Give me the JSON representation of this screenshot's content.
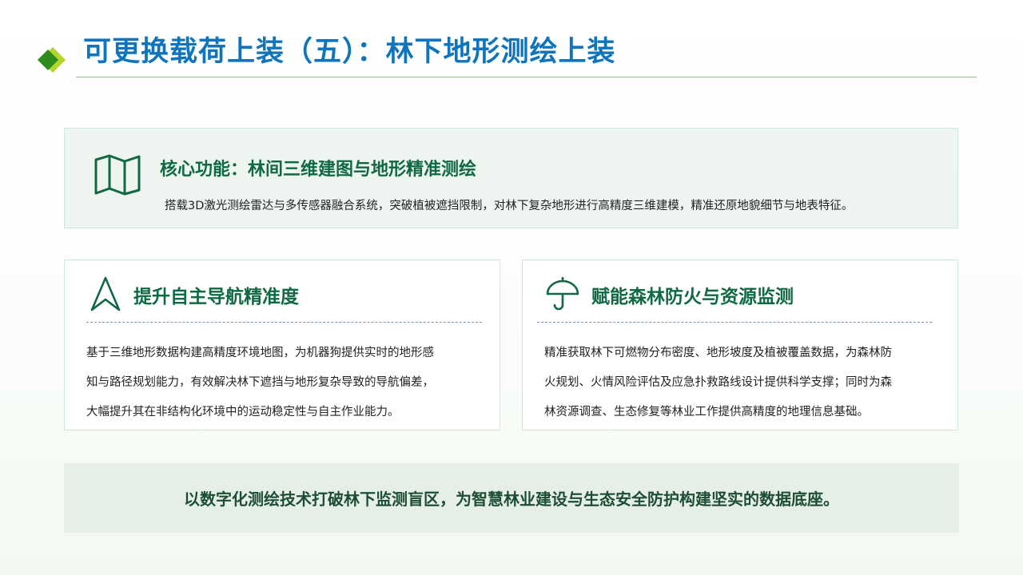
{
  "header": {
    "title": "可更换载荷上装（五）：林下地形测绘上装"
  },
  "core": {
    "icon": "folded-map-icon",
    "heading": "核心功能：林间三维建图与地形精准测绘",
    "text": "搭载3D激光测绘雷达与多传感器融合系统，突破植被遮挡限制，对林下复杂地形进行高精度三维建模，精准还原地貌细节与地表特征。"
  },
  "cards": [
    {
      "icon": "navigation-arrow-icon",
      "heading": "提升自主导航精准度",
      "lines": [
        "基于三维地形数据构建高精度环境地图，为机器狗提供实时的地形感",
        "知与路径规划能力，有效解决林下遮挡与地形复杂导致的导航偏差，",
        "大幅提升其在非结构化环境中的运动稳定性与自主作业能力。"
      ]
    },
    {
      "icon": "umbrella-icon",
      "heading": "赋能森林防火与资源监测",
      "lines": [
        "精准获取林下可燃物分布密度、地形坡度及植被覆盖数据，为森林防",
        "火规划、火情风险评估及应急扑救路线设计提供科学支撑；同时为森",
        "林资源调查、生态修复等林业工作提供高精度的地理信息基础。"
      ]
    }
  ],
  "conclusion": {
    "text": "以数字化测绘技术打破林下监测盲区，为智慧林业建设与生态安全防护构建坚实的数据底座。"
  },
  "colors": {
    "title_blue": "#0e74be",
    "heading_green": "#0f6a43",
    "logo_dark_green": "#2e8b1e",
    "logo_light_green": "#b3d428"
  }
}
